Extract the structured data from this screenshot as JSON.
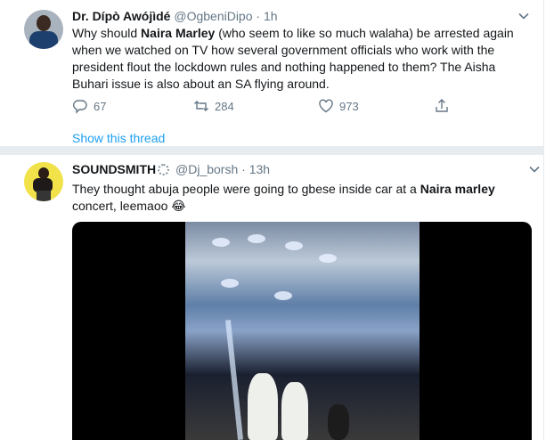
{
  "tweet1": {
    "name": "Dr. Dípò Awójìdé",
    "handle": "@OgbeniDipo",
    "separator": "·",
    "time": "1h",
    "text_a": "Why should ",
    "text_bold": "Naira Marley",
    "text_b": " (who seem to like so much walaha) be arrested again when we watched on TV how several government officials who work with the president flout the lockdown rules and nothing happened to them? The Aisha Buhari issue is also about an SA flying around.",
    "replies": "67",
    "retweets": "284",
    "likes": "973",
    "show_thread": "Show this thread"
  },
  "tweet2": {
    "name": "SOUNDSMITH",
    "handle": "@Dj_borsh",
    "separator": "·",
    "time": "13h",
    "text_a": "They thought abuja people were going to gbese inside car at a ",
    "text_bold": "Naira marley",
    "text_b": " concert, leemaoo 😂"
  },
  "colors": {
    "link": "#1da1f2",
    "muted": "#657786",
    "text": "#14171a",
    "divider": "#e6ecf0"
  }
}
